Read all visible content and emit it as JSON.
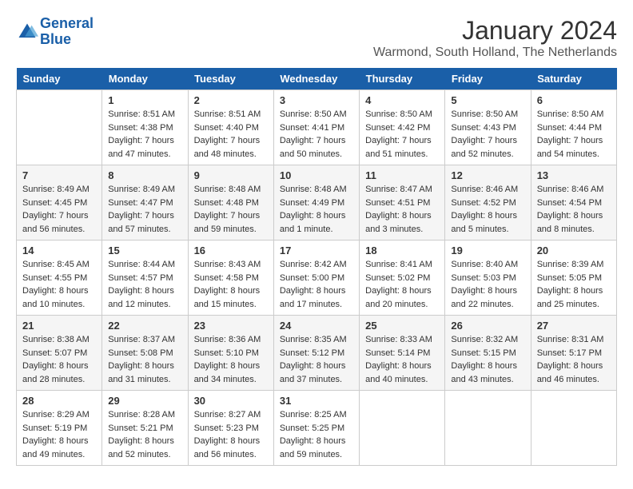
{
  "header": {
    "logo_line1": "General",
    "logo_line2": "Blue",
    "month_title": "January 2024",
    "location": "Warmond, South Holland, The Netherlands"
  },
  "days_of_week": [
    "Sunday",
    "Monday",
    "Tuesday",
    "Wednesday",
    "Thursday",
    "Friday",
    "Saturday"
  ],
  "weeks": [
    [
      {
        "day": "",
        "sunrise": "",
        "sunset": "",
        "daylight": ""
      },
      {
        "day": "1",
        "sunrise": "Sunrise: 8:51 AM",
        "sunset": "Sunset: 4:38 PM",
        "daylight": "Daylight: 7 hours and 47 minutes."
      },
      {
        "day": "2",
        "sunrise": "Sunrise: 8:51 AM",
        "sunset": "Sunset: 4:40 PM",
        "daylight": "Daylight: 7 hours and 48 minutes."
      },
      {
        "day": "3",
        "sunrise": "Sunrise: 8:50 AM",
        "sunset": "Sunset: 4:41 PM",
        "daylight": "Daylight: 7 hours and 50 minutes."
      },
      {
        "day": "4",
        "sunrise": "Sunrise: 8:50 AM",
        "sunset": "Sunset: 4:42 PM",
        "daylight": "Daylight: 7 hours and 51 minutes."
      },
      {
        "day": "5",
        "sunrise": "Sunrise: 8:50 AM",
        "sunset": "Sunset: 4:43 PM",
        "daylight": "Daylight: 7 hours and 52 minutes."
      },
      {
        "day": "6",
        "sunrise": "Sunrise: 8:50 AM",
        "sunset": "Sunset: 4:44 PM",
        "daylight": "Daylight: 7 hours and 54 minutes."
      }
    ],
    [
      {
        "day": "7",
        "sunrise": "Sunrise: 8:49 AM",
        "sunset": "Sunset: 4:45 PM",
        "daylight": "Daylight: 7 hours and 56 minutes."
      },
      {
        "day": "8",
        "sunrise": "Sunrise: 8:49 AM",
        "sunset": "Sunset: 4:47 PM",
        "daylight": "Daylight: 7 hours and 57 minutes."
      },
      {
        "day": "9",
        "sunrise": "Sunrise: 8:48 AM",
        "sunset": "Sunset: 4:48 PM",
        "daylight": "Daylight: 7 hours and 59 minutes."
      },
      {
        "day": "10",
        "sunrise": "Sunrise: 8:48 AM",
        "sunset": "Sunset: 4:49 PM",
        "daylight": "Daylight: 8 hours and 1 minute."
      },
      {
        "day": "11",
        "sunrise": "Sunrise: 8:47 AM",
        "sunset": "Sunset: 4:51 PM",
        "daylight": "Daylight: 8 hours and 3 minutes."
      },
      {
        "day": "12",
        "sunrise": "Sunrise: 8:46 AM",
        "sunset": "Sunset: 4:52 PM",
        "daylight": "Daylight: 8 hours and 5 minutes."
      },
      {
        "day": "13",
        "sunrise": "Sunrise: 8:46 AM",
        "sunset": "Sunset: 4:54 PM",
        "daylight": "Daylight: 8 hours and 8 minutes."
      }
    ],
    [
      {
        "day": "14",
        "sunrise": "Sunrise: 8:45 AM",
        "sunset": "Sunset: 4:55 PM",
        "daylight": "Daylight: 8 hours and 10 minutes."
      },
      {
        "day": "15",
        "sunrise": "Sunrise: 8:44 AM",
        "sunset": "Sunset: 4:57 PM",
        "daylight": "Daylight: 8 hours and 12 minutes."
      },
      {
        "day": "16",
        "sunrise": "Sunrise: 8:43 AM",
        "sunset": "Sunset: 4:58 PM",
        "daylight": "Daylight: 8 hours and 15 minutes."
      },
      {
        "day": "17",
        "sunrise": "Sunrise: 8:42 AM",
        "sunset": "Sunset: 5:00 PM",
        "daylight": "Daylight: 8 hours and 17 minutes."
      },
      {
        "day": "18",
        "sunrise": "Sunrise: 8:41 AM",
        "sunset": "Sunset: 5:02 PM",
        "daylight": "Daylight: 8 hours and 20 minutes."
      },
      {
        "day": "19",
        "sunrise": "Sunrise: 8:40 AM",
        "sunset": "Sunset: 5:03 PM",
        "daylight": "Daylight: 8 hours and 22 minutes."
      },
      {
        "day": "20",
        "sunrise": "Sunrise: 8:39 AM",
        "sunset": "Sunset: 5:05 PM",
        "daylight": "Daylight: 8 hours and 25 minutes."
      }
    ],
    [
      {
        "day": "21",
        "sunrise": "Sunrise: 8:38 AM",
        "sunset": "Sunset: 5:07 PM",
        "daylight": "Daylight: 8 hours and 28 minutes."
      },
      {
        "day": "22",
        "sunrise": "Sunrise: 8:37 AM",
        "sunset": "Sunset: 5:08 PM",
        "daylight": "Daylight: 8 hours and 31 minutes."
      },
      {
        "day": "23",
        "sunrise": "Sunrise: 8:36 AM",
        "sunset": "Sunset: 5:10 PM",
        "daylight": "Daylight: 8 hours and 34 minutes."
      },
      {
        "day": "24",
        "sunrise": "Sunrise: 8:35 AM",
        "sunset": "Sunset: 5:12 PM",
        "daylight": "Daylight: 8 hours and 37 minutes."
      },
      {
        "day": "25",
        "sunrise": "Sunrise: 8:33 AM",
        "sunset": "Sunset: 5:14 PM",
        "daylight": "Daylight: 8 hours and 40 minutes."
      },
      {
        "day": "26",
        "sunrise": "Sunrise: 8:32 AM",
        "sunset": "Sunset: 5:15 PM",
        "daylight": "Daylight: 8 hours and 43 minutes."
      },
      {
        "day": "27",
        "sunrise": "Sunrise: 8:31 AM",
        "sunset": "Sunset: 5:17 PM",
        "daylight": "Daylight: 8 hours and 46 minutes."
      }
    ],
    [
      {
        "day": "28",
        "sunrise": "Sunrise: 8:29 AM",
        "sunset": "Sunset: 5:19 PM",
        "daylight": "Daylight: 8 hours and 49 minutes."
      },
      {
        "day": "29",
        "sunrise": "Sunrise: 8:28 AM",
        "sunset": "Sunset: 5:21 PM",
        "daylight": "Daylight: 8 hours and 52 minutes."
      },
      {
        "day": "30",
        "sunrise": "Sunrise: 8:27 AM",
        "sunset": "Sunset: 5:23 PM",
        "daylight": "Daylight: 8 hours and 56 minutes."
      },
      {
        "day": "31",
        "sunrise": "Sunrise: 8:25 AM",
        "sunset": "Sunset: 5:25 PM",
        "daylight": "Daylight: 8 hours and 59 minutes."
      },
      {
        "day": "",
        "sunrise": "",
        "sunset": "",
        "daylight": ""
      },
      {
        "day": "",
        "sunrise": "",
        "sunset": "",
        "daylight": ""
      },
      {
        "day": "",
        "sunrise": "",
        "sunset": "",
        "daylight": ""
      }
    ]
  ]
}
